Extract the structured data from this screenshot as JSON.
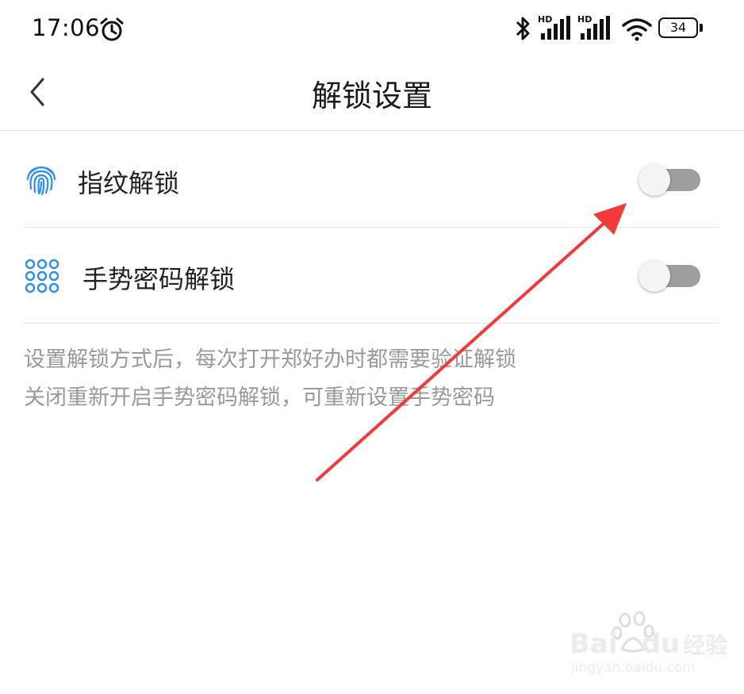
{
  "status_bar": {
    "time": "17:06",
    "signal_1_tag": "HD",
    "signal_2_tag": "HD",
    "battery": "34",
    "icons": [
      "alarm-icon",
      "bluetooth-icon",
      "signal-icon",
      "signal-icon",
      "wifi-icon",
      "battery-icon"
    ]
  },
  "header": {
    "title": "解锁设置",
    "back_icon": "chevron-left-icon"
  },
  "settings": [
    {
      "label": "指纹解锁",
      "icon": "fingerprint-icon",
      "enabled": false
    },
    {
      "label": "手势密码解锁",
      "icon": "dot-grid-icon",
      "enabled": false
    }
  ],
  "hint": {
    "line1": "设置解锁方式后，每次打开郑好办时都需要验证解锁",
    "line2": "关闭重新开启手势密码解锁，可重新设置手势密码"
  },
  "annotation": {
    "color": "#f23a3a"
  },
  "watermark": {
    "brand_left": "Bai",
    "brand_right": "du",
    "suffix": "经验",
    "url": "jingyan.baidu.com"
  },
  "colors": {
    "accent": "#2f8cf0",
    "toggle_track": "#9e9e9e",
    "toggle_knob": "#f4f4f4",
    "hint_text": "#9a9a9a"
  }
}
